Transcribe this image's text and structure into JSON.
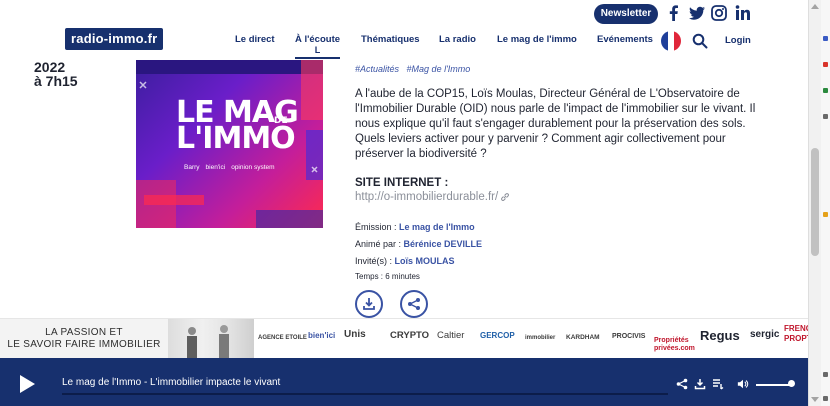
{
  "header": {
    "logo": "radio-immo.fr",
    "newsletter": "Newsletter",
    "nav": [
      "Le direct",
      "À l'écoute",
      "Thématiques",
      "La radio",
      "Le mag de l'immo",
      "Evénements"
    ],
    "nav_active_sub": "L",
    "login": "Login",
    "social_icons": [
      "facebook-icon",
      "twitter-icon",
      "instagram-icon",
      "linkedin-icon"
    ]
  },
  "episode": {
    "date_year": "2022",
    "date_time": "à 7h15",
    "tags": [
      "#Actualités",
      "#Mag de l'Immo"
    ],
    "description": "A l'aube de la COP15, Loïs Moulas, Directeur Général de L'Observatoire de l'Immobilier Durable (OID) nous parle de l'impact de l'immobilier sur le vivant. Il nous explique qu'il faut s'engager durablement pour la préservation des sols. Quels leviers activer pour y parvenir ? Comment agir collectivement pour préserver la biodiversité ?",
    "site_label": "SITE INTERNET :",
    "site_url": "http://o-immobilierdurable.fr/",
    "emission_label": "Émission : ",
    "emission_value": "Le mag de l'Immo",
    "anime_label": "Animé par : ",
    "anime_value": "Bérénice DEVILLE",
    "invite_label": "Invité(s) : ",
    "invite_value": "Loïs MOULAS",
    "duration": "Temps : 6 minutes"
  },
  "artwork": {
    "line1": "LE MAG",
    "line2": "L'IMMO",
    "de": "DE",
    "sponsors": [
      "Barry",
      "bien'ici",
      "opinion system"
    ]
  },
  "banner": {
    "slogan_line1": "LA PASSION ET",
    "slogan_line2": "LE SAVOIR FAIRE IMMOBILIER",
    "sponsors": [
      "AGENCE ETOILE",
      "bien'ici",
      "Unis",
      "CRYPTO",
      "Caltier",
      "GERCOP",
      "immobilier",
      "KARDHAM",
      "PROCIVIS",
      "Propriétés privées.com",
      "Regus",
      "sergic",
      "FRENCH PROPTECH"
    ]
  },
  "player": {
    "title": "Le mag de l'Immo - L'immobilier impacte le vivant"
  },
  "colors": {
    "brand_navy": "#17306e",
    "link_blue": "#3a53a4",
    "artwork_gradient": [
      "#3b1e9e",
      "#c41e9a",
      "#ff2a4d"
    ]
  }
}
